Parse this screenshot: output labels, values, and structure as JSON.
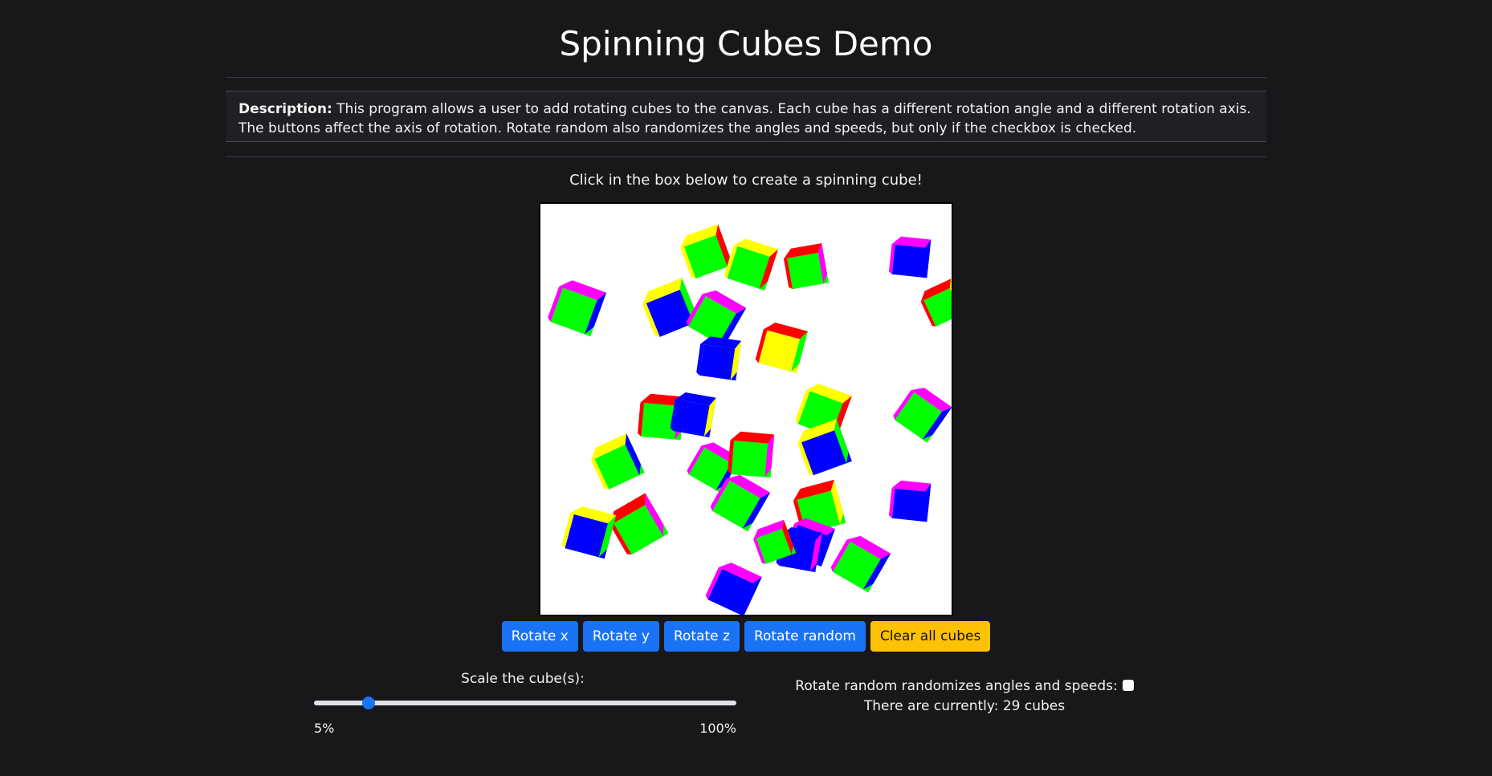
{
  "page": {
    "title": "Spinning Cubes Demo",
    "description_label": "Description:",
    "description_text": " This program allows a user to add rotating cubes to the canvas. Each cube has a different rotation angle and a different rotation axis. The buttons affect the axis of rotation. Rotate random also randomizes the angles and speeds, but only if the checkbox is checked.",
    "instruction": "Click in the box below to create a spinning cube!"
  },
  "controls": {
    "buttons": [
      "Rotate x",
      "Rotate y",
      "Rotate z",
      "Rotate random",
      "Clear all cubes"
    ],
    "scale_label": "Scale the cube(s):",
    "scale_min": "5%",
    "scale_max": "100%",
    "scale_value_fraction": 0.13,
    "randomize_label": "Rotate random randomizes angles and speeds:",
    "randomize_checked": false,
    "cube_count_text": "There are currently: 29 cubes"
  },
  "colors": {
    "background": "#18181b",
    "button_primary": "#1a73f5",
    "button_warning": "#ffc107",
    "cube_faces": [
      "#ff0000",
      "#00ff00",
      "#0000ff",
      "#ffff00",
      "#ff00ff"
    ]
  }
}
